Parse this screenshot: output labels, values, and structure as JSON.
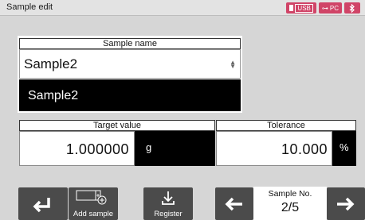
{
  "window": {
    "title": "Sample edit"
  },
  "status": {
    "usb_label": "USB",
    "pc_label": "PC",
    "accent": "#d04467"
  },
  "sample_name": {
    "label": "Sample name",
    "field_value": "Sample2",
    "display_value": "Sample2"
  },
  "target": {
    "label": "Target value",
    "value": "1.000000",
    "unit": "g"
  },
  "tolerance": {
    "label": "Tolerance",
    "value": "10.000",
    "unit": "%"
  },
  "toolbar": {
    "back_icon": "return-arrow-icon",
    "add_sample_label": "Add sample",
    "register_label": "Register",
    "prev_icon": "left-arrow-icon",
    "next_icon": "right-arrow-icon",
    "sample_no_label": "Sample No.",
    "sample_no_value": "2/5"
  }
}
